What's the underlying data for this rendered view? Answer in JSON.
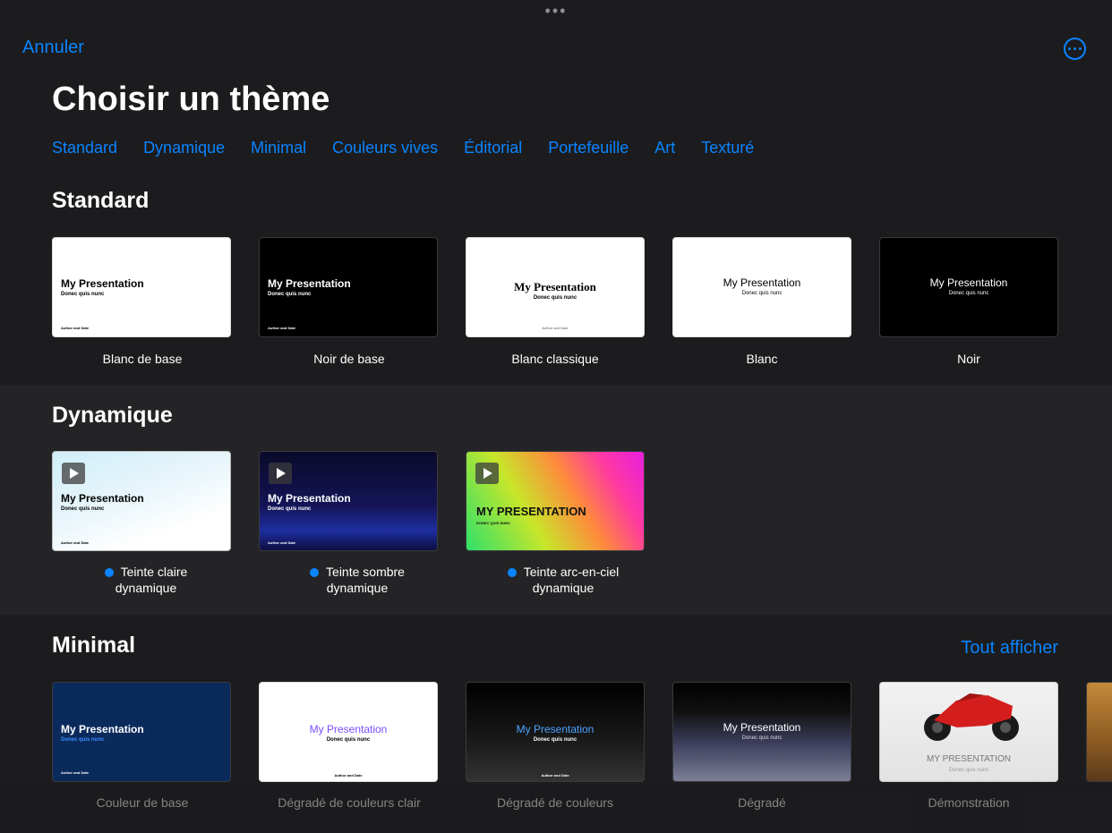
{
  "header": {
    "grabber": "•••",
    "cancel": "Annuler",
    "title": "Choisir un thème"
  },
  "categories": [
    "Standard",
    "Dynamique",
    "Minimal",
    "Couleurs vives",
    "Éditorial",
    "Portefeuille",
    "Art",
    "Texturé"
  ],
  "sections": {
    "standard": {
      "title": "Standard",
      "themes": [
        {
          "name": "Blanc de base",
          "t1": "My Presentation",
          "t2": "Donec quis nunc",
          "t3": "Author and Date"
        },
        {
          "name": "Noir de base",
          "t1": "My Presentation",
          "t2": "Donec quis nunc",
          "t3": "Author and Date"
        },
        {
          "name": "Blanc classique",
          "t1": "My Presentation",
          "t2": "Donec quis nunc",
          "t3": "Author and Date"
        },
        {
          "name": "Blanc",
          "t1": "My Presentation",
          "t2": "Donec quis nunc"
        },
        {
          "name": "Noir",
          "t1": "My Presentation",
          "t2": "Donec quis nunc"
        }
      ]
    },
    "dynamic": {
      "title": "Dynamique",
      "themes": [
        {
          "name_line1": "Teinte claire",
          "name_line2": "dynamique",
          "t1": "My Presentation",
          "t2": "Donec quis nunc",
          "t3": "Author and Date"
        },
        {
          "name_line1": "Teinte sombre",
          "name_line2": "dynamique",
          "t1": "My Presentation",
          "t2": "Donec quis nunc",
          "t3": "Author and Date"
        },
        {
          "name_line1": "Teinte arc-en-ciel",
          "name_line2": "dynamique",
          "t1": "MY PRESENTATION",
          "t2": "DONEC QUIS NUNC"
        }
      ]
    },
    "minimal": {
      "title": "Minimal",
      "see_all": "Tout afficher",
      "themes": [
        {
          "name": "Couleur de base",
          "t1": "My Presentation",
          "t2": "Donec quis nunc",
          "t3": "Author and Date"
        },
        {
          "name": "Dégradé de couleurs clair",
          "t1": "My Presentation",
          "t2": "Donec quis nunc",
          "t3": "Author and Date"
        },
        {
          "name": "Dégradé de couleurs",
          "t1": "My Presentation",
          "t2": "Donec quis nunc",
          "t3": "Author and Date"
        },
        {
          "name": "Dégradé",
          "t1": "My Presentation",
          "t2": "Donec quis nunc"
        },
        {
          "name": "Démonstration",
          "t1": "MY PRESENTATION",
          "t2": "Donec quis nunc"
        }
      ]
    }
  },
  "colors": {
    "accent": "#0a84ff",
    "background": "#1c1c1e",
    "section_alt": "#242426"
  }
}
